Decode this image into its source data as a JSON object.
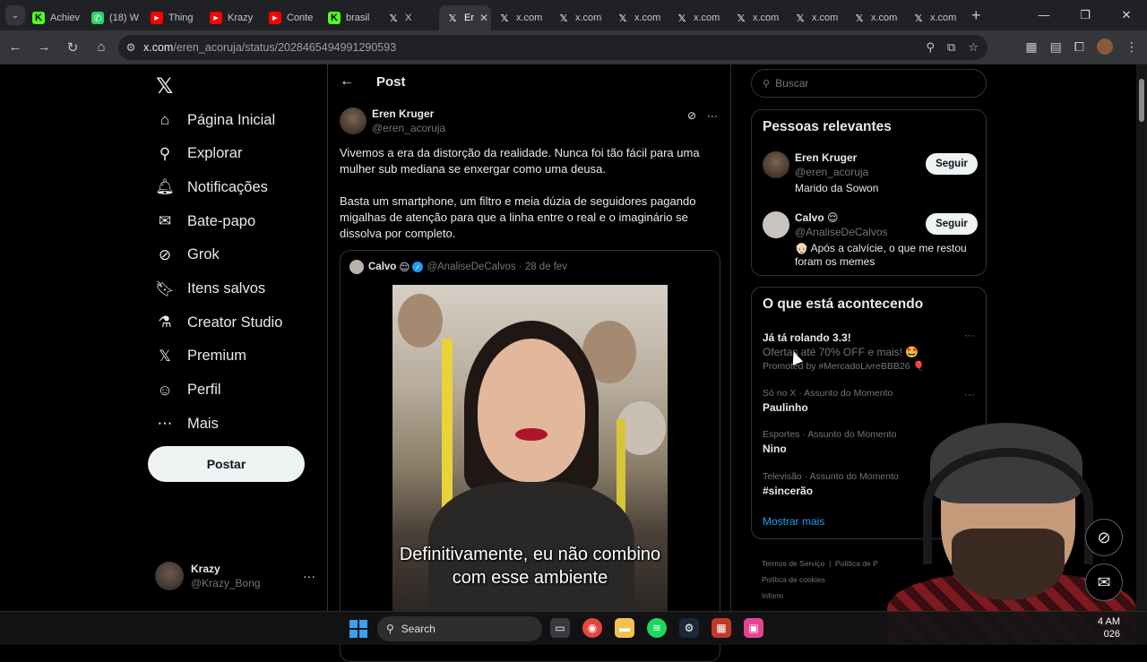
{
  "browser": {
    "tabs": [
      {
        "label": "Achiev",
        "icon": "kick-icon",
        "color": "#53fc18"
      },
      {
        "label": "(18) W",
        "icon": "whatsapp-icon",
        "color": "#25d366"
      },
      {
        "label": "Thing",
        "icon": "youtube-icon",
        "color": "#ff0000"
      },
      {
        "label": "Krazy",
        "icon": "youtube-icon",
        "color": "#ff0000"
      },
      {
        "label": "Conte",
        "icon": "youtube-icon",
        "color": "#ff0000"
      },
      {
        "label": "brasil",
        "icon": "kick-icon",
        "color": "#53fc18"
      },
      {
        "label": "X",
        "icon": "x-icon",
        "color": "#ffffff"
      },
      {
        "label": "Er",
        "icon": "x-icon",
        "color": "#ffffff",
        "active": true
      },
      {
        "label": "x.com",
        "icon": "x-icon",
        "color": "#ffffff"
      },
      {
        "label": "x.com",
        "icon": "x-icon",
        "color": "#ffffff"
      },
      {
        "label": "x.com",
        "icon": "x-icon",
        "color": "#ffffff"
      },
      {
        "label": "x.com",
        "icon": "x-icon",
        "color": "#ffffff"
      },
      {
        "label": "x.com",
        "icon": "x-icon",
        "color": "#ffffff"
      },
      {
        "label": "x.com",
        "icon": "x-icon",
        "color": "#ffffff"
      },
      {
        "label": "x.com",
        "icon": "x-icon",
        "color": "#ffffff"
      },
      {
        "label": "x.com",
        "icon": "x-icon",
        "color": "#ffffff"
      }
    ],
    "url_host": "x.com",
    "url_path": "/eren_acoruja/status/2028465494991290593"
  },
  "nav": {
    "items": [
      {
        "label": "Página Inicial",
        "icon": "home-icon"
      },
      {
        "label": "Explorar",
        "icon": "search-icon"
      },
      {
        "label": "Notificações",
        "icon": "bell-icon"
      },
      {
        "label": "Bate-papo",
        "icon": "mail-icon"
      },
      {
        "label": "Grok",
        "icon": "grok-icon"
      },
      {
        "label": "Itens salvos",
        "icon": "bookmark-icon"
      },
      {
        "label": "Creator Studio",
        "icon": "flask-icon"
      },
      {
        "label": "Premium",
        "icon": "x-icon"
      },
      {
        "label": "Perfil",
        "icon": "person-icon"
      },
      {
        "label": "Mais",
        "icon": "more-circle-icon"
      }
    ],
    "post_button": "Postar",
    "account": {
      "name": "Krazy",
      "handle": "@Krazy_Bong"
    }
  },
  "post": {
    "header": "Post",
    "author_name": "Eren Kruger",
    "author_handle": "@eren_acoruja",
    "text_1": "Vivemos a era da distorção da realidade. Nunca foi tão fácil para uma mulher sub mediana se enxergar como uma deusa.",
    "text_2": "Basta um smartphone, um filtro e meia dúzia de seguidores pagando migalhas de atenção para que a linha entre o real e o imaginário se dissolva por completo.",
    "quote": {
      "name": "Calvo",
      "emoji": "😌",
      "handle": "@AnaliseDeCalvos",
      "date": "28 de fev",
      "caption": "Definitivamente, eu não combino com esse ambiente"
    }
  },
  "right": {
    "search_placeholder": "Buscar",
    "relevant_title": "Pessoas relevantes",
    "people": [
      {
        "name": "Eren Kruger",
        "handle": "@eren_acoruja",
        "bio": "Marido da Sowon",
        "button": "Seguir"
      },
      {
        "name": "Calvo 😌",
        "handle": "@AnaliseDeCalvos",
        "bio": "👴🏻 Após a calvície, o que me restou foram os memes",
        "button": "Seguir"
      }
    ],
    "trends_title": "O que está acontecendo",
    "promo": {
      "name": "Já tá rolando 3.3!",
      "sub": "Ofertas até 70% OFF e mais! 🤩",
      "promoted": "Promoted by #MercadoLivreBBB26 🎈"
    },
    "trends": [
      {
        "category": "Só no X · Assunto do Momento",
        "name": "Paulinho"
      },
      {
        "category": "Esportes · Assunto do Momento",
        "name": "Nino"
      },
      {
        "category": "Televisão · Assunto do Momento",
        "name": "#sincerão"
      }
    ],
    "show_more": "Mostrar mais",
    "footer": [
      "Termos de Serviço",
      "Política de P",
      "Política de cookies",
      "Inform"
    ]
  },
  "taskbar": {
    "search_label": "Search",
    "clock_time": "4 AM",
    "clock_date": "026"
  },
  "colors": {
    "accent": "#1d9bf0",
    "background": "#000000",
    "border": "#2f3336",
    "muted": "#71767b"
  }
}
